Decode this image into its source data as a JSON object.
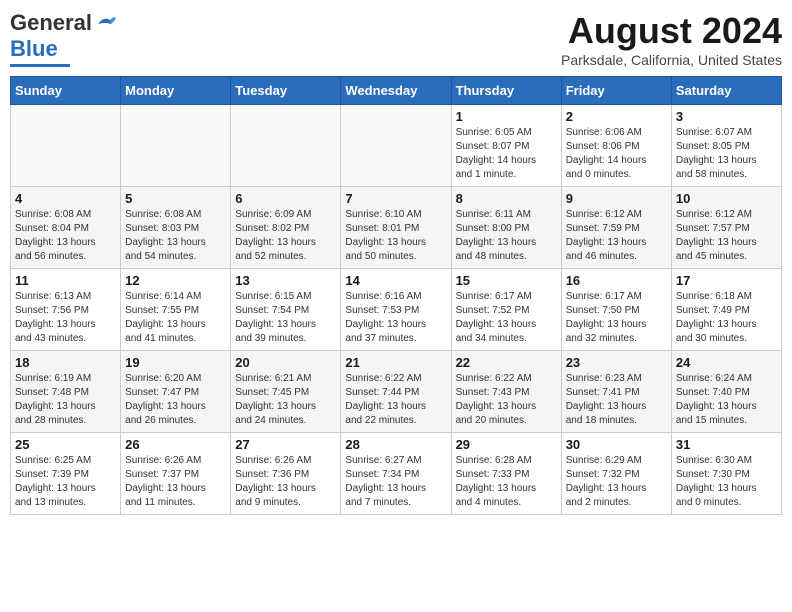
{
  "header": {
    "logo_general": "General",
    "logo_blue": "Blue",
    "month_title": "August 2024",
    "location": "Parksdale, California, United States"
  },
  "weekdays": [
    "Sunday",
    "Monday",
    "Tuesday",
    "Wednesday",
    "Thursday",
    "Friday",
    "Saturday"
  ],
  "weeks": [
    [
      {
        "day": "",
        "info": ""
      },
      {
        "day": "",
        "info": ""
      },
      {
        "day": "",
        "info": ""
      },
      {
        "day": "",
        "info": ""
      },
      {
        "day": "1",
        "info": "Sunrise: 6:05 AM\nSunset: 8:07 PM\nDaylight: 14 hours\nand 1 minute."
      },
      {
        "day": "2",
        "info": "Sunrise: 6:06 AM\nSunset: 8:06 PM\nDaylight: 14 hours\nand 0 minutes."
      },
      {
        "day": "3",
        "info": "Sunrise: 6:07 AM\nSunset: 8:05 PM\nDaylight: 13 hours\nand 58 minutes."
      }
    ],
    [
      {
        "day": "4",
        "info": "Sunrise: 6:08 AM\nSunset: 8:04 PM\nDaylight: 13 hours\nand 56 minutes."
      },
      {
        "day": "5",
        "info": "Sunrise: 6:08 AM\nSunset: 8:03 PM\nDaylight: 13 hours\nand 54 minutes."
      },
      {
        "day": "6",
        "info": "Sunrise: 6:09 AM\nSunset: 8:02 PM\nDaylight: 13 hours\nand 52 minutes."
      },
      {
        "day": "7",
        "info": "Sunrise: 6:10 AM\nSunset: 8:01 PM\nDaylight: 13 hours\nand 50 minutes."
      },
      {
        "day": "8",
        "info": "Sunrise: 6:11 AM\nSunset: 8:00 PM\nDaylight: 13 hours\nand 48 minutes."
      },
      {
        "day": "9",
        "info": "Sunrise: 6:12 AM\nSunset: 7:59 PM\nDaylight: 13 hours\nand 46 minutes."
      },
      {
        "day": "10",
        "info": "Sunrise: 6:12 AM\nSunset: 7:57 PM\nDaylight: 13 hours\nand 45 minutes."
      }
    ],
    [
      {
        "day": "11",
        "info": "Sunrise: 6:13 AM\nSunset: 7:56 PM\nDaylight: 13 hours\nand 43 minutes."
      },
      {
        "day": "12",
        "info": "Sunrise: 6:14 AM\nSunset: 7:55 PM\nDaylight: 13 hours\nand 41 minutes."
      },
      {
        "day": "13",
        "info": "Sunrise: 6:15 AM\nSunset: 7:54 PM\nDaylight: 13 hours\nand 39 minutes."
      },
      {
        "day": "14",
        "info": "Sunrise: 6:16 AM\nSunset: 7:53 PM\nDaylight: 13 hours\nand 37 minutes."
      },
      {
        "day": "15",
        "info": "Sunrise: 6:17 AM\nSunset: 7:52 PM\nDaylight: 13 hours\nand 34 minutes."
      },
      {
        "day": "16",
        "info": "Sunrise: 6:17 AM\nSunset: 7:50 PM\nDaylight: 13 hours\nand 32 minutes."
      },
      {
        "day": "17",
        "info": "Sunrise: 6:18 AM\nSunset: 7:49 PM\nDaylight: 13 hours\nand 30 minutes."
      }
    ],
    [
      {
        "day": "18",
        "info": "Sunrise: 6:19 AM\nSunset: 7:48 PM\nDaylight: 13 hours\nand 28 minutes."
      },
      {
        "day": "19",
        "info": "Sunrise: 6:20 AM\nSunset: 7:47 PM\nDaylight: 13 hours\nand 26 minutes."
      },
      {
        "day": "20",
        "info": "Sunrise: 6:21 AM\nSunset: 7:45 PM\nDaylight: 13 hours\nand 24 minutes."
      },
      {
        "day": "21",
        "info": "Sunrise: 6:22 AM\nSunset: 7:44 PM\nDaylight: 13 hours\nand 22 minutes."
      },
      {
        "day": "22",
        "info": "Sunrise: 6:22 AM\nSunset: 7:43 PM\nDaylight: 13 hours\nand 20 minutes."
      },
      {
        "day": "23",
        "info": "Sunrise: 6:23 AM\nSunset: 7:41 PM\nDaylight: 13 hours\nand 18 minutes."
      },
      {
        "day": "24",
        "info": "Sunrise: 6:24 AM\nSunset: 7:40 PM\nDaylight: 13 hours\nand 15 minutes."
      }
    ],
    [
      {
        "day": "25",
        "info": "Sunrise: 6:25 AM\nSunset: 7:39 PM\nDaylight: 13 hours\nand 13 minutes."
      },
      {
        "day": "26",
        "info": "Sunrise: 6:26 AM\nSunset: 7:37 PM\nDaylight: 13 hours\nand 11 minutes."
      },
      {
        "day": "27",
        "info": "Sunrise: 6:26 AM\nSunset: 7:36 PM\nDaylight: 13 hours\nand 9 minutes."
      },
      {
        "day": "28",
        "info": "Sunrise: 6:27 AM\nSunset: 7:34 PM\nDaylight: 13 hours\nand 7 minutes."
      },
      {
        "day": "29",
        "info": "Sunrise: 6:28 AM\nSunset: 7:33 PM\nDaylight: 13 hours\nand 4 minutes."
      },
      {
        "day": "30",
        "info": "Sunrise: 6:29 AM\nSunset: 7:32 PM\nDaylight: 13 hours\nand 2 minutes."
      },
      {
        "day": "31",
        "info": "Sunrise: 6:30 AM\nSunset: 7:30 PM\nDaylight: 13 hours\nand 0 minutes."
      }
    ]
  ]
}
